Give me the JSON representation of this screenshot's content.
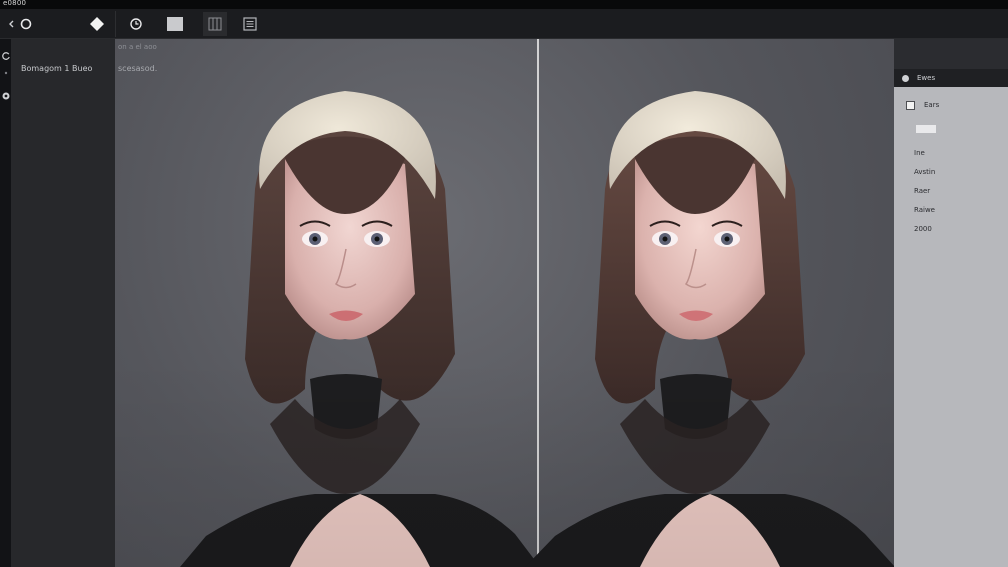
{
  "window": {
    "title": "e0800"
  },
  "left_panel": {
    "label": "Bomagom 1 Bueo"
  },
  "canvas": {
    "breadcrumb": "on a el aoo",
    "zoom_text": "scesasod."
  },
  "right_panel": {
    "header": "Ewes",
    "section_title": "Ears",
    "items": [
      "Ine",
      "Avstin",
      "Raer",
      "Raiwe",
      "2000"
    ]
  }
}
